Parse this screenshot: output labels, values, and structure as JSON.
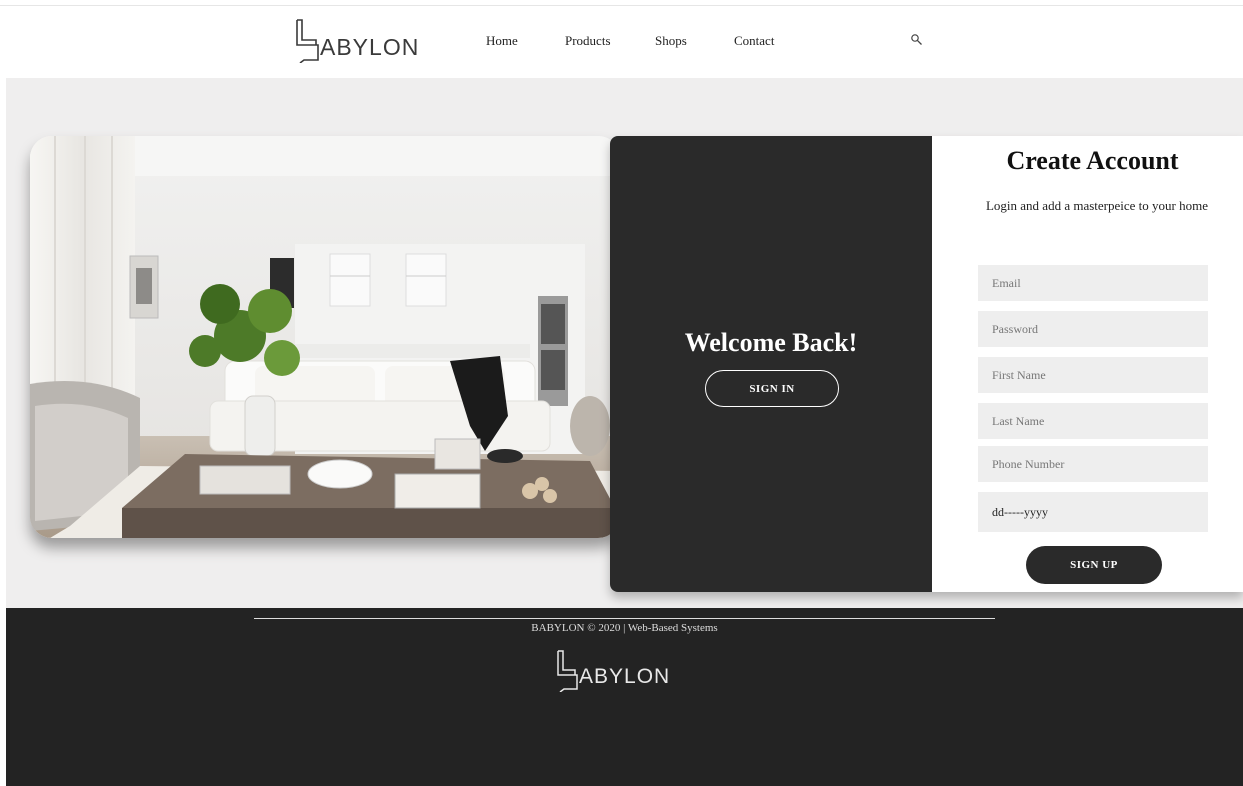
{
  "brand": {
    "logo_text": "ABYLON"
  },
  "nav": {
    "items": [
      {
        "label": "Home"
      },
      {
        "label": "Products"
      },
      {
        "label": "Shops"
      },
      {
        "label": "Contact"
      }
    ],
    "search_icon": "search-icon"
  },
  "welcome": {
    "title": "Welcome Back!",
    "signin_label": "SIGN IN"
  },
  "signup": {
    "title": "Create Account",
    "subtitle": "Login and add a masterpeice to your home",
    "fields": {
      "email_placeholder": "Email",
      "password_placeholder": "Password",
      "first_name_placeholder": "First Name",
      "last_name_placeholder": "Last Name",
      "phone_placeholder": "Phone Number",
      "date_value": "dd-----yyyy"
    },
    "submit_label": "SIGN UP"
  },
  "footer": {
    "copyright": "BABYLON © 2020 | Web-Based Systems",
    "logo_text": "ABYLON"
  },
  "colors": {
    "dark_panel": "#2a2a2a",
    "footer_bg": "#232323",
    "stage_bg": "#efeeee",
    "field_bg": "#eeeeee"
  }
}
